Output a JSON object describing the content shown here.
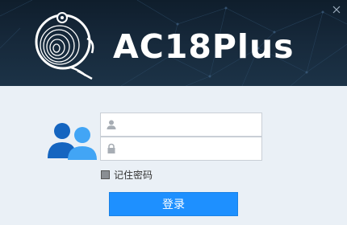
{
  "app": {
    "title": "AC18Plus"
  },
  "login": {
    "username_value": "",
    "password_value": "",
    "remember_label": "记住密码",
    "remember_checked": false,
    "login_button_label": "登录"
  },
  "icons": {
    "close": "close-icon",
    "logo": "webcam-logo-icon",
    "users": "users-icon",
    "user_field": "person-icon",
    "password_field": "lock-icon"
  },
  "colors": {
    "header_bg": "#16283a",
    "content_bg": "#eaf0f6",
    "accent": "#1e90ff",
    "users_icon_dark": "#1565c0",
    "users_icon_light": "#42a5f5"
  }
}
